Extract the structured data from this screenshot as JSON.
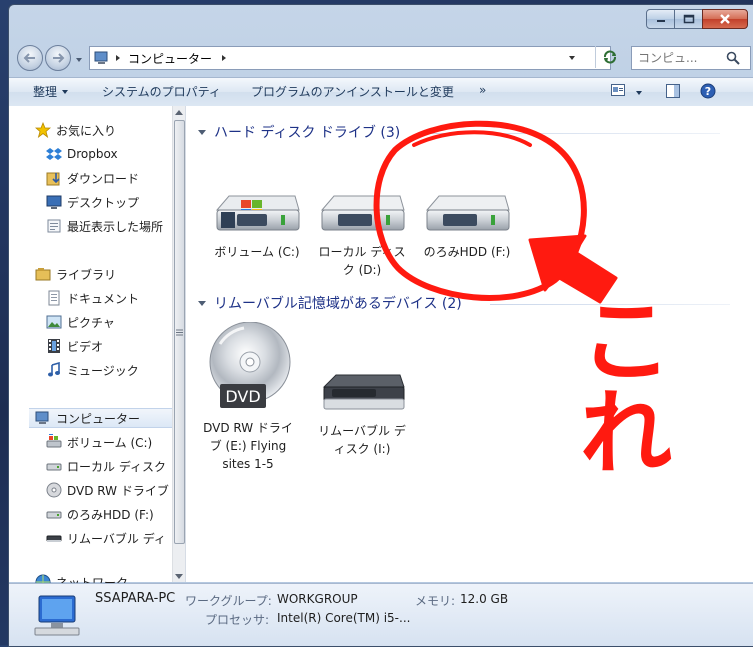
{
  "address": {
    "crumb": "コンピューター"
  },
  "search": {
    "placeholder": "コンピュ..."
  },
  "toolbar": {
    "organize": "整理",
    "system_properties": "システムのプロパティ",
    "uninstall": "プログラムのアンインストールと変更",
    "more": "»"
  },
  "sidebar": {
    "favorites": {
      "label": "お気に入り",
      "items": [
        "Dropbox",
        "ダウンロード",
        "デスクトップ",
        "最近表示した場所"
      ]
    },
    "libraries": {
      "label": "ライブラリ",
      "items": [
        "ドキュメント",
        "ピクチャ",
        "ビデオ",
        "ミュージック"
      ]
    },
    "computer": {
      "label": "コンピューター",
      "items": [
        "ボリューム (C:)",
        "ローカル ディスク",
        "DVD RW ドライブ",
        "のろみHDD (F:)",
        "リムーバブル ディ"
      ]
    },
    "network": {
      "label": "ネットワーク"
    }
  },
  "groups": {
    "hdd": {
      "title": "ハード ディスク ドライブ (3)",
      "items": [
        {
          "line1": "ボリューム (C:)",
          "line2": "",
          "icon": "windows-drive-icon"
        },
        {
          "line1": "ローカル ディス",
          "line2": "ク (D:)",
          "icon": "hard-drive-icon"
        },
        {
          "line1": "のろみHDD (F:)",
          "line2": "",
          "icon": "hard-drive-icon"
        }
      ]
    },
    "removable": {
      "title": "リムーバブル記憶域があるデバイス (2)",
      "items": [
        {
          "line1": "DVD RW ドライ",
          "line2": "ブ (E:) Flying",
          "line3": "sites 1-5",
          "icon": "dvd-drive-icon",
          "badge": "DVD"
        },
        {
          "line1": "リムーバブル デ",
          "line2": "ィスク (I:)",
          "icon": "removable-disk-icon"
        }
      ]
    }
  },
  "status": {
    "computer_name": "SSAPARA-PC",
    "workgroup_label": "ワークグループ:",
    "workgroup_value": "WORKGROUP",
    "memory_label": "メモリ:",
    "memory_value": "12.0 GB",
    "processor_label": "プロセッサ:",
    "processor_value": "Intel(R) Core(TM) i5-..."
  },
  "annotation": {
    "text": "これ",
    "color": "#ff1a10"
  }
}
